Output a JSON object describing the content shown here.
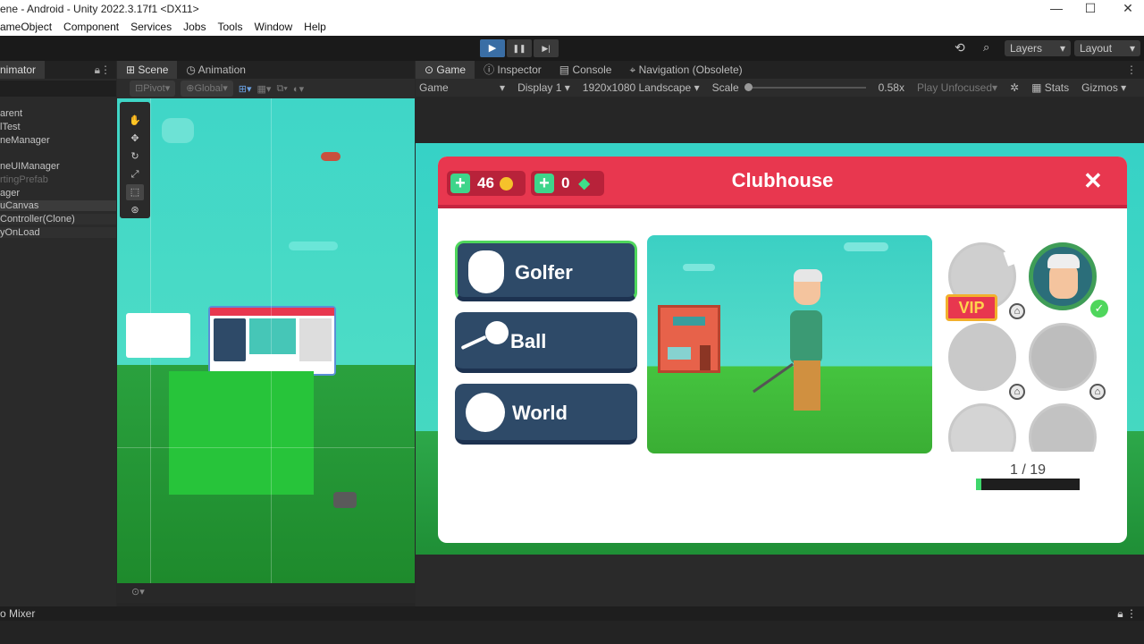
{
  "window": {
    "title": "ene - Android - Unity 2022.3.17f1 <DX11>",
    "controls": [
      "—",
      "☐",
      "✕"
    ]
  },
  "menu": [
    "ameObject",
    "Component",
    "Services",
    "Jobs",
    "Tools",
    "Window",
    "Help"
  ],
  "toolbar": {
    "play": "▶",
    "pause": "❚❚",
    "step": "▶|",
    "layers": "Layers",
    "layout": "Layout"
  },
  "hierarchy": {
    "tab": "nimator",
    "items": [
      "arent",
      "lTest",
      "neManager",
      "",
      "neUIManager",
      "rtingPrefab",
      "ager",
      "uCanvas",
      "Controller(Clone)",
      "yOnLoad"
    ]
  },
  "scene_panel": {
    "tabs": [
      "Scene",
      "Animation"
    ],
    "pivot": "Pivot",
    "global": "Global"
  },
  "game_panel": {
    "tabs": [
      "Game",
      "Inspector",
      "Console",
      "Navigation (Obsolete)"
    ],
    "game_label": "Game",
    "display": "Display 1",
    "resolution": "1920x1080 Landscape",
    "scale_label": "Scale",
    "scale_value": "0.58x",
    "play_mode": "Play Unfocused",
    "stats": "Stats",
    "gizmos": "Gizmos"
  },
  "game": {
    "title": "Clubhouse",
    "coins": "46",
    "gems": "0",
    "close": "✕",
    "categories": [
      "Golfer",
      "Ball",
      "World"
    ],
    "vip": "VIP",
    "progress_text": "1 / 19",
    "progress": 0.05,
    "colors": {
      "header": "#e8374f",
      "button": "#2e4a68",
      "selected": "#4fd65c"
    }
  },
  "bottom": {
    "mixer": "o Mixer"
  }
}
